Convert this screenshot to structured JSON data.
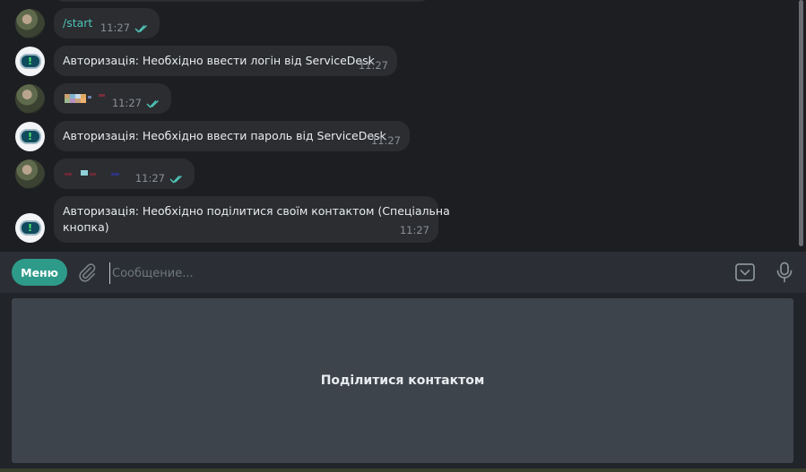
{
  "chat": {
    "messages": [
      {
        "sender": "user",
        "text": "/start",
        "time": "11:27",
        "read": true
      },
      {
        "sender": "bot",
        "text": "Авторизація: Необхідно ввести логін від ServiceDesk",
        "time": "11:27"
      },
      {
        "sender": "user",
        "text": "",
        "time": "11:27",
        "read": true,
        "redacted": true
      },
      {
        "sender": "bot",
        "text": "Авторизація: Необхідно ввести пароль від ServiceDesk",
        "time": "11:27"
      },
      {
        "sender": "user",
        "text": "",
        "time": "11:27",
        "read": true,
        "redacted": true
      },
      {
        "sender": "bot",
        "text_line1": "Авторизація: Необхідно поділитися своїм контактом (Спеціальна",
        "text_line2": "кнопка)",
        "time": "11:27"
      }
    ]
  },
  "composer": {
    "menu_label": "Меню",
    "placeholder": "Сообщение...",
    "value": "",
    "attach_icon": "paperclip-icon",
    "keyboard_icon": "keyboard-toggle-icon",
    "mic_icon": "microphone-icon"
  },
  "reply_keyboard": {
    "buttons": [
      {
        "label": "Поділитися контактом"
      }
    ]
  },
  "colors": {
    "accent": "#2e9b8a",
    "read_ticks": "#4fc3b7",
    "bubble": "#2b2d31",
    "chat_bg": "#1d1e22"
  }
}
